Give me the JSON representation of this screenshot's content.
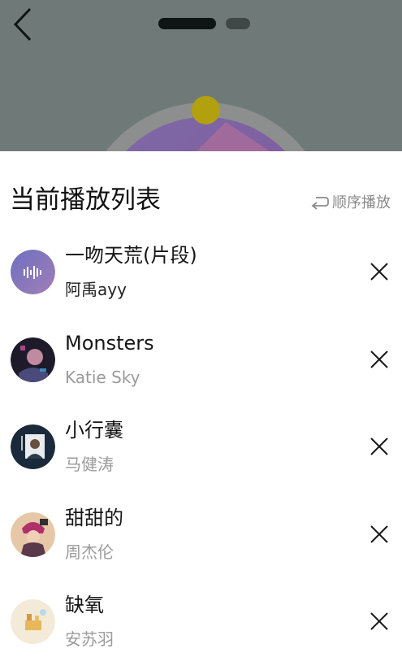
{
  "player": {
    "back_icon": "chevron-left-icon"
  },
  "playlist": {
    "title": "当前播放列表",
    "mode_label": "顺序播放",
    "mode_icon": "loop-order-icon",
    "items": [
      {
        "title": "一吻天荒(片段)",
        "artist": "阿禹ayy",
        "cover": "waveform-cover"
      },
      {
        "title": "Monsters",
        "artist": "Katie Sky",
        "cover": "album-cover"
      },
      {
        "title": "小行囊",
        "artist": "马健涛",
        "cover": "album-cover"
      },
      {
        "title": "甜甜的",
        "artist": "周杰伦",
        "cover": "album-cover"
      },
      {
        "title": "缺氧",
        "artist": "安苏羽",
        "cover": "album-cover"
      }
    ],
    "remove_icon": "close-icon"
  },
  "colors": {
    "overlay": "#6f7a78",
    "title_text": "#111111",
    "secondary_text": "#9a9a9a",
    "knob": "#b3a00e"
  }
}
